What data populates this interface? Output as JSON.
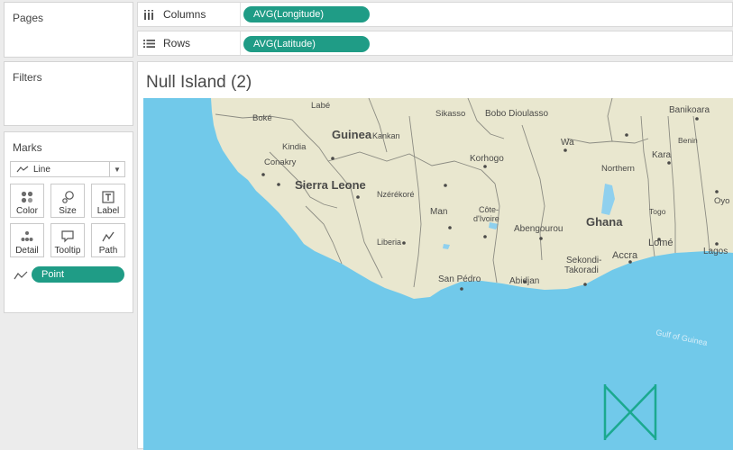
{
  "cards": {
    "pages": "Pages",
    "filters": "Filters",
    "marks": "Marks"
  },
  "marks": {
    "type": "Line",
    "buttons": {
      "color": "Color",
      "size": "Size",
      "label": "Label",
      "detail": "Detail",
      "tooltip": "Tooltip",
      "path": "Path"
    },
    "path_field": "Point"
  },
  "shelves": {
    "columns_label": "Columns",
    "columns_field": "AVG(Longitude)",
    "rows_label": "Rows",
    "rows_field": "AVG(Latitude)"
  },
  "viz": {
    "title": "Null Island (2)"
  },
  "map": {
    "labels": {
      "labe": "Labé",
      "boke": "Boké",
      "kindia": "Kindia",
      "conakry": "Conakry",
      "guinea": "Guinea",
      "kankan": "Kankan",
      "sierra_leone": "Sierra Leone",
      "nzerekore": "Nzérékoré",
      "liberia": "Liberia",
      "sikasso": "Sikasso",
      "bobo": "Bobo Dioulasso",
      "korhogo": "Korhogo",
      "man": "Man",
      "cote_divoire": "Côte-\nd'Ivoire",
      "abengourou": "Abengourou",
      "san_pedro": "San Pédro",
      "abidjan": "Abidjan",
      "wa": "Wa",
      "ghana": "Ghana",
      "northern": "Northern",
      "kara": "Kara",
      "benin": "Benin",
      "banikoara": "Banikoara",
      "togo": "Togo",
      "oyo": "Oyo",
      "lome": "Lomé",
      "accra": "Accra",
      "sekondi": "Sekondi-\nTakoradi",
      "lagos": "Lagos",
      "gulf": "Gulf of Guinea"
    },
    "colors": {
      "land": "#e9e7cf",
      "ocean": "#71c9ea",
      "lake": "#8fd0ee",
      "border": "#8b8b82",
      "logo": "#1ba98f"
    }
  }
}
